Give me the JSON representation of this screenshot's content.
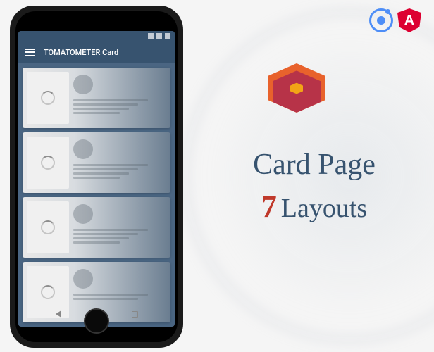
{
  "app": {
    "title": "TOMATOMETER Card"
  },
  "promo": {
    "title": "Card Page",
    "count": "7",
    "subtitle": "Layouts"
  },
  "icons": {
    "ionic": "ionic-framework",
    "angular": "angular-framework",
    "angular_letter": "A"
  }
}
